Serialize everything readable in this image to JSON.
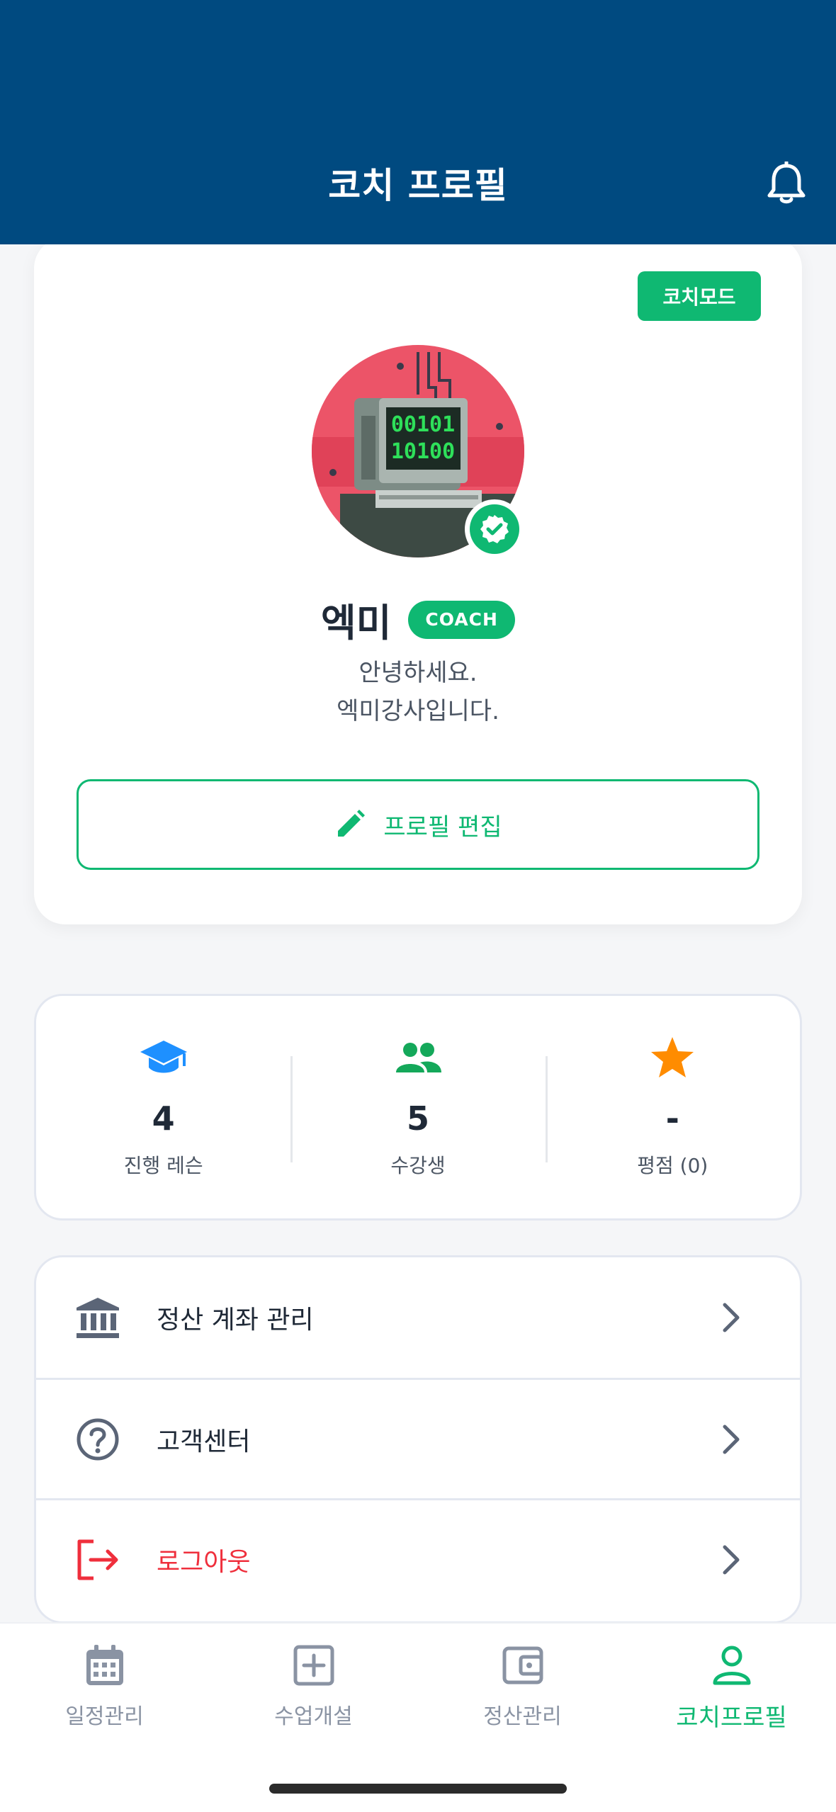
{
  "header": {
    "title": "코치 프로필",
    "bell_icon": "bell-icon",
    "background": "#004a80"
  },
  "profile": {
    "mode_badge": "코치모드",
    "name": "엑미",
    "role_badge": "COACH",
    "bio_line1": "안녕하세요.",
    "bio_line2": "엑미강사입니다.",
    "edit_button": "프로필 편집",
    "avatar_screen_line1": "00101",
    "avatar_screen_line2": "10100",
    "accent": "#0fb872"
  },
  "stats": [
    {
      "icon": "graduation-cap-icon",
      "value": "4",
      "label": "진행 레슨",
      "color": "#1e90ff"
    },
    {
      "icon": "people-icon",
      "value": "5",
      "label": "수강생",
      "color": "#14a85a"
    },
    {
      "icon": "star-icon",
      "value": "-",
      "label": "평점 (0)",
      "color": "#ff8c00"
    }
  ],
  "menu": [
    {
      "icon": "bank-icon",
      "label": "정산 계좌 관리"
    },
    {
      "icon": "help-circle-icon",
      "label": "고객센터"
    },
    {
      "icon": "logout-icon",
      "label": "로그아웃",
      "color": "#ef2f3c"
    }
  ],
  "tabbar": [
    {
      "icon": "calendar-icon",
      "label": "일정관리",
      "active": false
    },
    {
      "icon": "plus-square-icon",
      "label": "수업개설",
      "active": false
    },
    {
      "icon": "wallet-icon",
      "label": "정산관리",
      "active": false
    },
    {
      "icon": "person-icon",
      "label": "코치프로필",
      "active": true
    }
  ]
}
